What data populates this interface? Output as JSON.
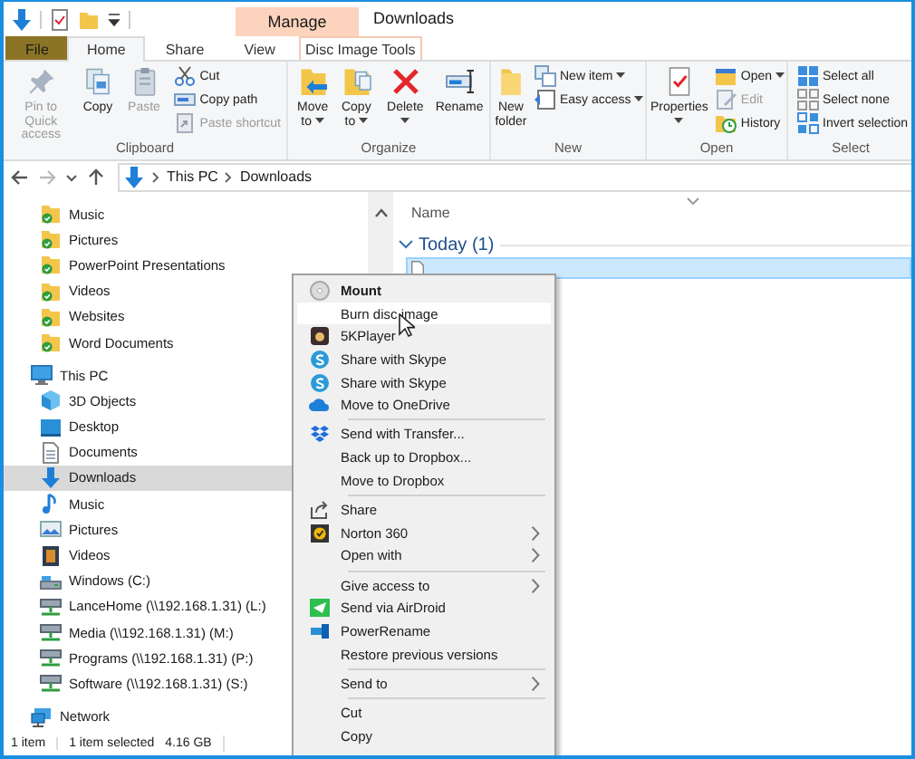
{
  "window": {
    "title": "Downloads"
  },
  "ribbon": {
    "tabs": [
      {
        "label": "File",
        "kind": "file",
        "selected": false
      },
      {
        "label": "Home",
        "kind": "tab",
        "selected": true
      },
      {
        "label": "Share",
        "kind": "tab",
        "selected": false
      },
      {
        "label": "View",
        "kind": "tab",
        "selected": false
      },
      {
        "label": "Disc Image Tools",
        "kind": "contextual",
        "header": "Manage",
        "selected": false
      }
    ],
    "groups": [
      {
        "label": "Clipboard",
        "large": [
          {
            "label": "Pin to Quick\naccess",
            "disabled": true,
            "dropdown": false
          },
          {
            "label": "Copy",
            "disabled": false,
            "dropdown": false
          },
          {
            "label": "Paste",
            "disabled": true,
            "dropdown": false
          }
        ],
        "small": [
          {
            "label": "Cut",
            "disabled": false,
            "dropdown": false
          },
          {
            "label": "Copy path",
            "disabled": false,
            "dropdown": false
          },
          {
            "label": "Paste shortcut",
            "disabled": true,
            "dropdown": false
          }
        ]
      },
      {
        "label": "Organize",
        "large": [
          {
            "label": "Move\nto",
            "disabled": false,
            "dropdown": true
          },
          {
            "label": "Copy\nto",
            "disabled": false,
            "dropdown": true
          },
          {
            "label": "Delete",
            "disabled": false,
            "dropdown": true
          },
          {
            "label": "Rename",
            "disabled": false,
            "dropdown": false
          }
        ]
      },
      {
        "label": "New",
        "large": [
          {
            "label": "New\nfolder",
            "disabled": false,
            "dropdown": false
          }
        ],
        "small": [
          {
            "label": "New item",
            "disabled": false,
            "dropdown": true
          },
          {
            "label": "Easy access",
            "disabled": false,
            "dropdown": true
          }
        ]
      },
      {
        "label": "Open",
        "large": [
          {
            "label": "Properties",
            "disabled": false,
            "dropdown": true
          }
        ],
        "small": [
          {
            "label": "Open",
            "disabled": false,
            "dropdown": true
          },
          {
            "label": "Edit",
            "disabled": true,
            "dropdown": false
          },
          {
            "label": "History",
            "disabled": false,
            "dropdown": false
          }
        ]
      },
      {
        "label": "Select",
        "small": [
          {
            "label": "Select all",
            "disabled": false,
            "dropdown": false
          },
          {
            "label": "Select none",
            "disabled": false,
            "dropdown": false
          },
          {
            "label": "Invert selection",
            "disabled": false,
            "dropdown": false
          }
        ]
      }
    ]
  },
  "address_bar": {
    "path": [
      "This PC",
      "Downloads"
    ]
  },
  "navigation_pane": {
    "quick_access": [
      {
        "label": "Music",
        "kind": "synced-folder",
        "selected": false
      },
      {
        "label": "Pictures",
        "kind": "synced-folder",
        "selected": false
      },
      {
        "label": "PowerPoint Presentations",
        "kind": "synced-folder",
        "selected": false
      },
      {
        "label": "Videos",
        "kind": "synced-folder",
        "selected": false
      },
      {
        "label": "Websites",
        "kind": "synced-folder",
        "selected": false
      },
      {
        "label": "Word Documents",
        "kind": "synced-folder",
        "selected": false
      }
    ],
    "tree": [
      {
        "label": "This PC",
        "kind": "computer",
        "selected": false,
        "children": [
          {
            "label": "3D Objects",
            "kind": "objects",
            "selected": false
          },
          {
            "label": "Desktop",
            "kind": "desktop",
            "selected": false
          },
          {
            "label": "Documents",
            "kind": "documents",
            "selected": false
          },
          {
            "label": "Downloads",
            "kind": "downloads",
            "selected": true
          },
          {
            "label": "Music",
            "kind": "music",
            "selected": false
          },
          {
            "label": "Pictures",
            "kind": "pictures",
            "selected": false
          },
          {
            "label": "Videos",
            "kind": "videos",
            "selected": false
          },
          {
            "label": "Windows (C:)",
            "kind": "drive",
            "selected": false
          },
          {
            "label": "LanceHome (\\\\192.168.1.31) (L:)",
            "kind": "net-drive",
            "selected": false
          },
          {
            "label": "Media (\\\\192.168.1.31) (M:)",
            "kind": "net-drive",
            "selected": false
          },
          {
            "label": "Programs (\\\\192.168.1.31) (P:)",
            "kind": "net-drive",
            "selected": false
          },
          {
            "label": "Software (\\\\192.168.1.31) (S:)",
            "kind": "net-drive",
            "selected": false
          }
        ]
      },
      {
        "label": "Network",
        "kind": "network",
        "selected": false
      }
    ]
  },
  "file_list": {
    "columns": [
      "Name"
    ],
    "groups": [
      {
        "label": "Today (1)",
        "expanded": true,
        "rows": [
          {
            "selected": true
          }
        ]
      }
    ]
  },
  "context_menu": {
    "groups": [
      [
        {
          "label": "Mount",
          "default": true,
          "selected": false,
          "submenu": false
        },
        {
          "label": "Burn disc image",
          "default": false,
          "selected": true,
          "submenu": false
        },
        {
          "label": "5KPlayer",
          "default": false,
          "selected": false,
          "submenu": false
        },
        {
          "label": "Share with Skype",
          "default": false,
          "selected": false,
          "submenu": false
        },
        {
          "label": "Share with Skype",
          "default": false,
          "selected": false,
          "submenu": false
        },
        {
          "label": "Move to OneDrive",
          "default": false,
          "selected": false,
          "submenu": false
        }
      ],
      [
        {
          "label": "Send with Transfer...",
          "default": false,
          "selected": false,
          "submenu": false
        },
        {
          "label": "Back up to Dropbox...",
          "default": false,
          "selected": false,
          "submenu": false
        },
        {
          "label": "Move to Dropbox",
          "default": false,
          "selected": false,
          "submenu": false
        }
      ],
      [
        {
          "label": "Share",
          "default": false,
          "selected": false,
          "submenu": false
        },
        {
          "label": "Norton 360",
          "default": false,
          "selected": false,
          "submenu": true
        },
        {
          "label": "Open with",
          "default": false,
          "selected": false,
          "submenu": true
        }
      ],
      [
        {
          "label": "Give access to",
          "default": false,
          "selected": false,
          "submenu": true
        },
        {
          "label": "Send via AirDroid",
          "default": false,
          "selected": false,
          "submenu": false
        },
        {
          "label": "PowerRename",
          "default": false,
          "selected": false,
          "submenu": false
        },
        {
          "label": "Restore previous versions",
          "default": false,
          "selected": false,
          "submenu": false
        }
      ],
      [
        {
          "label": "Send to",
          "default": false,
          "selected": false,
          "submenu": true
        }
      ],
      [
        {
          "label": "Cut",
          "default": false,
          "selected": false,
          "submenu": false
        },
        {
          "label": "Copy",
          "default": false,
          "selected": false,
          "submenu": false
        }
      ]
    ]
  },
  "status_bar": {
    "items": [
      "1 item",
      "1 item selected",
      "4.16 GB"
    ]
  }
}
